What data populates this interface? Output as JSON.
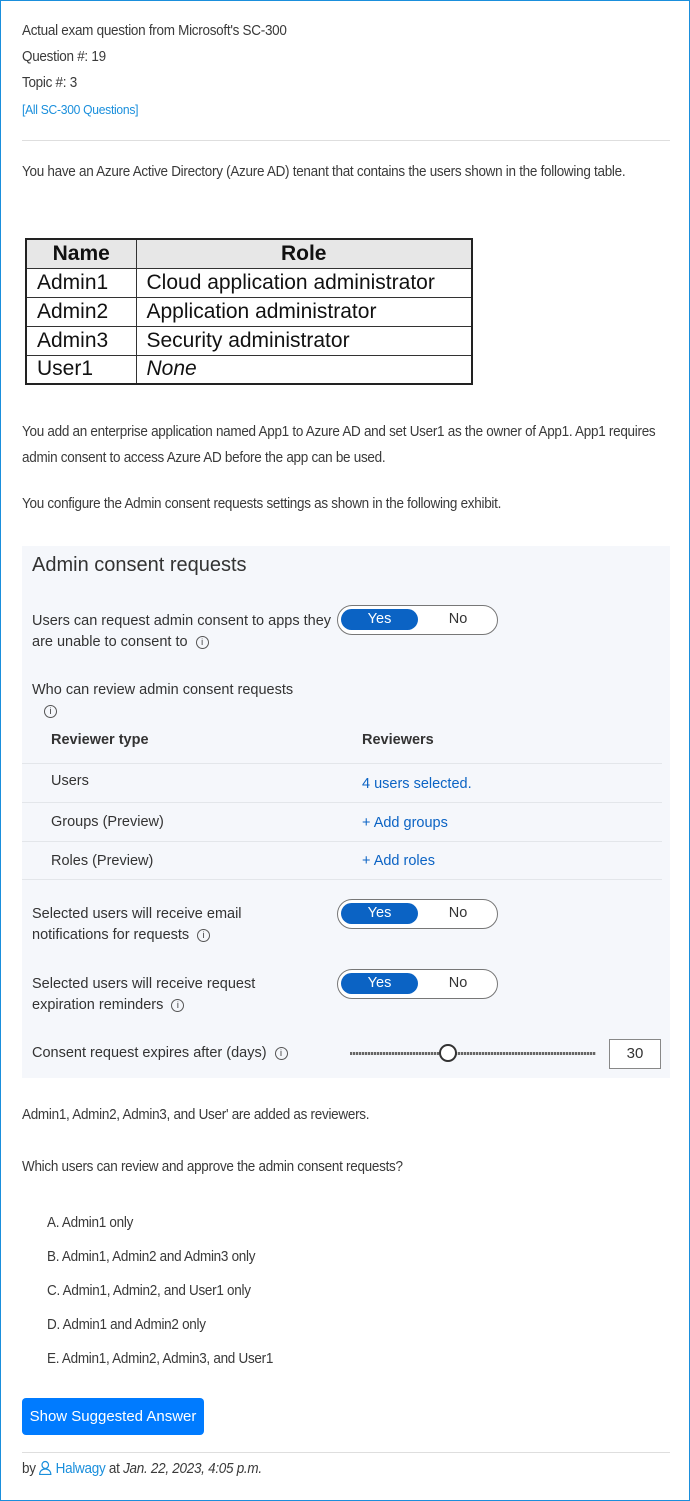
{
  "header": {
    "title": "Actual exam question from Microsoft's SC-300",
    "question": "Question #: 19",
    "topic": "Topic #: 3",
    "all_link": "[All SC-300 Questions]"
  },
  "question": {
    "intro": "You have an Azure Active Directory (Azure AD) tenant that contains the users shown in the following table.",
    "table": {
      "headers": [
        "Name",
        "Role"
      ],
      "rows": [
        [
          "Admin1",
          "Cloud application administrator"
        ],
        [
          "Admin2",
          "Application administrator"
        ],
        [
          "Admin3",
          "Security administrator"
        ],
        [
          "User1",
          "None"
        ]
      ]
    },
    "p2": "You add an enterprise application named App1 to Azure AD and set User1 as the owner of App1. App1 requires admin consent to access Azure AD before the app can be used.",
    "p3": "You configure the Admin consent requests settings as shown in the following exhibit.",
    "p4": "Admin1, Admin2, Admin3, and User' are added as reviewers.",
    "p5": "Which users can review and approve the admin consent requests?"
  },
  "exhibit": {
    "title": "Admin consent requests",
    "setting1": {
      "label": "Users can request admin consent to apps they are unable to consent to",
      "yes": "Yes",
      "no": "No"
    },
    "who_label": "Who can review admin consent requests",
    "col_type": "Reviewer type",
    "col_reviewers": "Reviewers",
    "rows": [
      {
        "type": "Users",
        "value": "4 users selected."
      },
      {
        "type": "Groups (Preview)",
        "value": "+ Add groups"
      },
      {
        "type": "Roles (Preview)",
        "value": "+ Add roles"
      }
    ],
    "setting2": {
      "label": "Selected users will receive email notifications for requests",
      "yes": "Yes",
      "no": "No"
    },
    "setting3": {
      "label": "Selected users will receive request expiration reminders",
      "yes": "Yes",
      "no": "No"
    },
    "expires": {
      "label": "Consent request expires after (days)",
      "value": "30",
      "slider_fraction": 0.4
    },
    "info": "i"
  },
  "options": [
    "A. Admin1 only",
    "B. Admin1, Admin2 and Admin3 only",
    "C. Admin1, Admin2, and User1 only",
    "D. Admin1 and Admin2 only",
    "E. Admin1, Admin2, Admin3, and User1"
  ],
  "button": "Show Suggested Answer",
  "footer": {
    "by": "by",
    "user": "Halwagy",
    "at": "at",
    "date": "Jan. 22, 2023, 4:05 p.m."
  }
}
